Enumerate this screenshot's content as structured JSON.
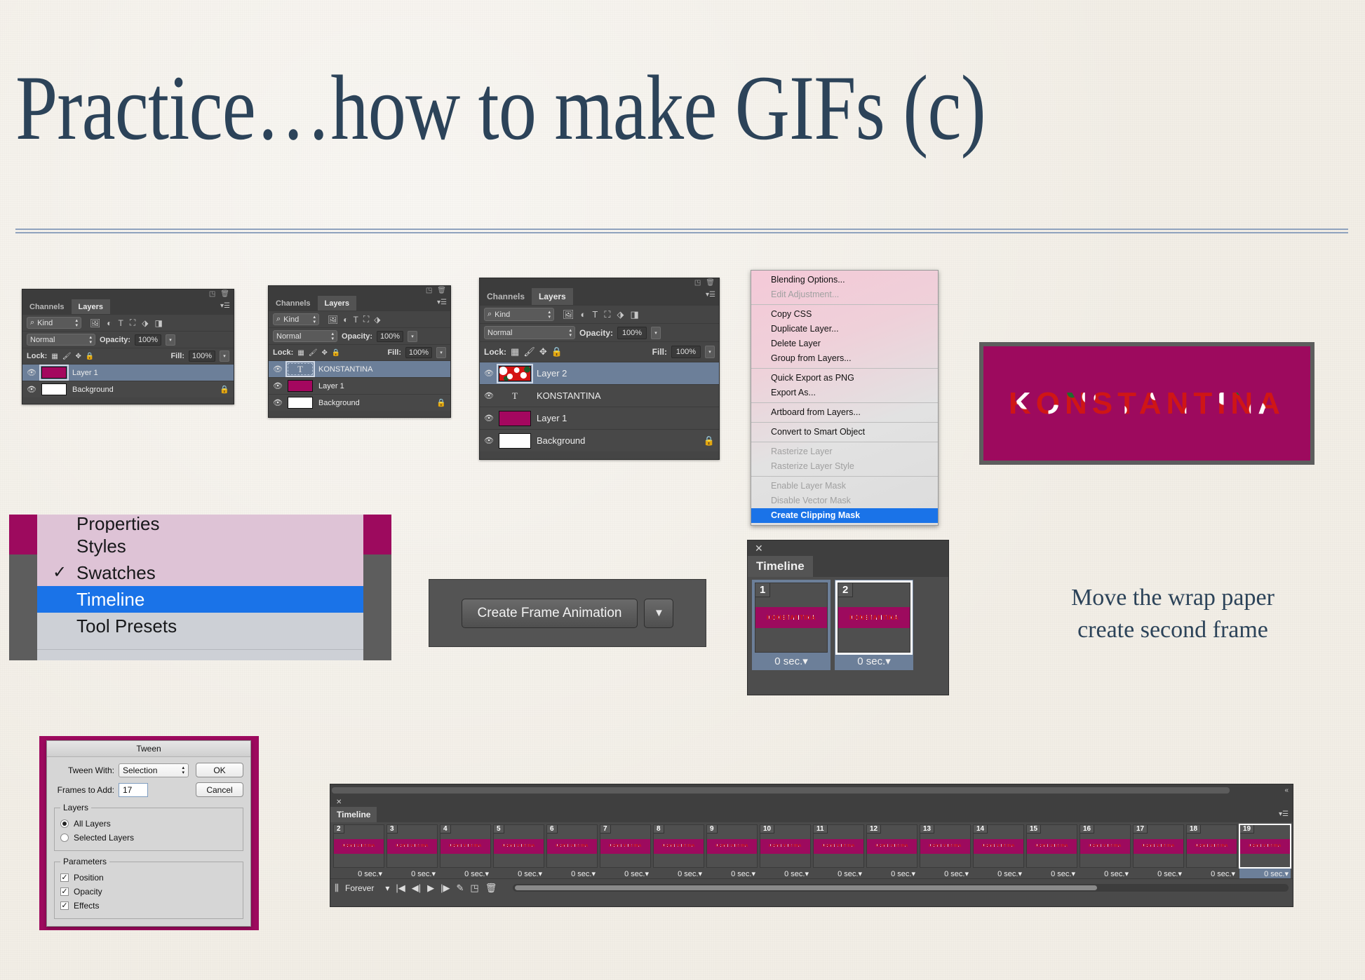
{
  "slide": {
    "title": "Practice…how to make GIFs (c)",
    "annotation_line1": "Move the wrap paper",
    "annotation_line2": "create second frame",
    "accent_navy": "#2c4359",
    "accent_magenta": "#9d0a5e",
    "highlight_blue": "#1a73e8",
    "background": "#f2eee6"
  },
  "panel1": {
    "tabs": [
      "Channels",
      "Layers"
    ],
    "active_tab": "Layers",
    "filter": "Kind",
    "blend_mode": "Normal",
    "opacity_label": "Opacity:",
    "opacity_value": "100%",
    "lock_label": "Lock:",
    "fill_label": "Fill:",
    "fill_value": "100%",
    "layers": [
      {
        "name": "Layer 1",
        "thumb": "magenta",
        "selected": true,
        "locked": false
      },
      {
        "name": "Background",
        "thumb": "white",
        "selected": false,
        "locked": true
      }
    ]
  },
  "panel2": {
    "tabs": [
      "Channels",
      "Layers"
    ],
    "active_tab": "Layers",
    "filter": "Kind",
    "blend_mode": "Normal",
    "opacity_label": "Opacity:",
    "opacity_value": "100%",
    "lock_label": "Lock:",
    "fill_label": "Fill:",
    "fill_value": "100%",
    "layers": [
      {
        "name": "KONSTANTINA",
        "thumb": "text",
        "selected": true,
        "locked": false
      },
      {
        "name": "Layer 1",
        "thumb": "magenta",
        "selected": false,
        "locked": false
      },
      {
        "name": "Background",
        "thumb": "white",
        "selected": false,
        "locked": true
      }
    ]
  },
  "panel3": {
    "tabs": [
      "Channels",
      "Layers"
    ],
    "active_tab": "Layers",
    "filter": "Kind",
    "blend_mode": "Normal",
    "opacity_label": "Opacity:",
    "opacity_value": "100%",
    "lock_label": "Lock:",
    "fill_label": "Fill:",
    "fill_value": "100%",
    "layers": [
      {
        "name": "Layer 2",
        "thumb": "floral",
        "selected": true,
        "locked": false
      },
      {
        "name": "KONSTANTINA",
        "thumb": "text",
        "selected": false,
        "locked": false
      },
      {
        "name": "Layer 1",
        "thumb": "magenta",
        "selected": false,
        "locked": false
      },
      {
        "name": "Background",
        "thumb": "white",
        "selected": false,
        "locked": true
      }
    ]
  },
  "context_menu": {
    "groups": [
      [
        {
          "label": "Blending Options...",
          "state": "normal"
        },
        {
          "label": "Edit Adjustment...",
          "state": "disabled"
        }
      ],
      [
        {
          "label": "Copy CSS",
          "state": "normal"
        },
        {
          "label": "Duplicate Layer...",
          "state": "normal"
        },
        {
          "label": "Delete Layer",
          "state": "normal"
        },
        {
          "label": "Group from Layers...",
          "state": "normal"
        }
      ],
      [
        {
          "label": "Quick Export as PNG",
          "state": "normal"
        },
        {
          "label": "Export As...",
          "state": "normal"
        }
      ],
      [
        {
          "label": "Artboard from Layers...",
          "state": "normal"
        }
      ],
      [
        {
          "label": "Convert to Smart Object",
          "state": "normal"
        }
      ],
      [
        {
          "label": "Rasterize Layer",
          "state": "disabled"
        },
        {
          "label": "Rasterize Layer Style",
          "state": "disabled"
        }
      ],
      [
        {
          "label": "Enable Layer Mask",
          "state": "disabled"
        },
        {
          "label": "Disable Vector Mask",
          "state": "disabled"
        },
        {
          "label": "Create Clipping Mask",
          "state": "highlighted"
        }
      ]
    ]
  },
  "artwork": {
    "word": "KONSTANTINA"
  },
  "window_menu": {
    "items": [
      {
        "label": "Properties",
        "state": "pink",
        "checked": false,
        "clipped": true
      },
      {
        "label": "Styles",
        "state": "pink",
        "checked": false
      },
      {
        "label": "Swatches",
        "state": "pink",
        "checked": true
      },
      {
        "label": "Timeline",
        "state": "highlighted",
        "checked": false
      },
      {
        "label": "Tool Presets",
        "state": "plain",
        "checked": false
      }
    ],
    "check_glyph": "✓"
  },
  "create_frame_animation": {
    "button_label": "Create Frame Animation",
    "dropdown_glyph": "▼"
  },
  "timeline_small": {
    "tab_label": "Timeline",
    "close_glyph": "✕",
    "frames": [
      {
        "number": "1",
        "duration": "0 sec.",
        "selected": false,
        "label": "KONSTANTINA"
      },
      {
        "number": "2",
        "duration": "0 sec.",
        "selected": true,
        "label": "KONSTANTINA"
      }
    ],
    "duration_arrow": "▾"
  },
  "tween_dialog": {
    "title": "Tween",
    "tween_with_label": "Tween With:",
    "tween_with_value": "Selection",
    "frames_to_add_label": "Frames to Add:",
    "frames_to_add_value": "17",
    "ok_label": "OK",
    "cancel_label": "Cancel",
    "layers_legend": "Layers",
    "layers_options": [
      {
        "label": "All Layers",
        "selected": true
      },
      {
        "label": "Selected Layers",
        "selected": false
      }
    ],
    "parameters_legend": "Parameters",
    "parameters_options": [
      {
        "label": "Position",
        "checked": true
      },
      {
        "label": "Opacity",
        "checked": true
      },
      {
        "label": "Effects",
        "checked": true
      }
    ],
    "check_glyph": "✓"
  },
  "timeline_big": {
    "tab_label": "Timeline",
    "close_glyph": "✕",
    "loop_value": "Forever",
    "duration_arrow": "▾",
    "frames": [
      {
        "number": "2",
        "duration": "0 sec.",
        "selected": false
      },
      {
        "number": "3",
        "duration": "0 sec.",
        "selected": false
      },
      {
        "number": "4",
        "duration": "0 sec.",
        "selected": false
      },
      {
        "number": "5",
        "duration": "0 sec.",
        "selected": false
      },
      {
        "number": "6",
        "duration": "0 sec.",
        "selected": false
      },
      {
        "number": "7",
        "duration": "0 sec.",
        "selected": false
      },
      {
        "number": "8",
        "duration": "0 sec.",
        "selected": false
      },
      {
        "number": "9",
        "duration": "0 sec.",
        "selected": false
      },
      {
        "number": "10",
        "duration": "0 sec.",
        "selected": false
      },
      {
        "number": "11",
        "duration": "0 sec.",
        "selected": false
      },
      {
        "number": "12",
        "duration": "0 sec.",
        "selected": false
      },
      {
        "number": "13",
        "duration": "0 sec.",
        "selected": false
      },
      {
        "number": "14",
        "duration": "0 sec.",
        "selected": false
      },
      {
        "number": "15",
        "duration": "0 sec.",
        "selected": false
      },
      {
        "number": "16",
        "duration": "0 sec.",
        "selected": false
      },
      {
        "number": "17",
        "duration": "0 sec.",
        "selected": false
      },
      {
        "number": "18",
        "duration": "0 sec.",
        "selected": false
      },
      {
        "number": "19",
        "duration": "0 sec.",
        "selected": true
      }
    ],
    "frame_label": "KONSTANTINA",
    "controls": [
      "select-first-frame",
      "previous-frame",
      "play",
      "next-frame",
      "tween",
      "duplicate-frame",
      "delete-frame"
    ]
  }
}
